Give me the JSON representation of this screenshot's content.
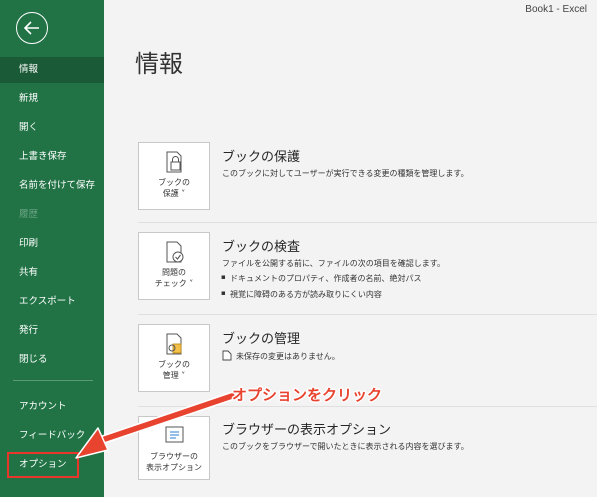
{
  "window": {
    "title": "Book1  -  Excel"
  },
  "sidebar": {
    "items": [
      {
        "label": "情報",
        "active": true
      },
      {
        "label": "新規"
      },
      {
        "label": "開く"
      },
      {
        "label": "上書き保存"
      },
      {
        "label": "名前を付けて保存"
      },
      {
        "label": "履歴",
        "disabled": true
      },
      {
        "label": "印刷"
      },
      {
        "label": "共有"
      },
      {
        "label": "エクスポート"
      },
      {
        "label": "発行"
      },
      {
        "label": "閉じる"
      },
      {
        "label": "アカウント"
      },
      {
        "label": "フィードバック"
      },
      {
        "label": "オプション"
      }
    ]
  },
  "main": {
    "title": "情報",
    "sections": [
      {
        "button_line1": "ブックの",
        "button_line2": "保護 ˅",
        "title": "ブックの保護",
        "desc": "このブックに対してユーザーが実行できる変更の種類を管理します。"
      },
      {
        "button_line1": "問題の",
        "button_line2": "チェック ˅",
        "title": "ブックの検査",
        "desc": "ファイルを公開する前に、ファイルの次の項目を確認します。",
        "bullets": [
          "ドキュメントのプロパティ、作成者の名前、絶対パス",
          "視覚に障碍のある方が読み取りにくい内容"
        ]
      },
      {
        "button_line1": "ブックの",
        "button_line2": "管理 ˅",
        "title": "ブックの管理",
        "desc": "未保存の変更はありません。"
      },
      {
        "button_line1": "ブラウザーの",
        "button_line2": "表示オプション",
        "title": "ブラウザーの表示オプション",
        "desc": "このブックをブラウザーで開いたときに表示される内容を選びます。"
      }
    ]
  },
  "annotation": {
    "callout": "オプションをクリック"
  },
  "colors": {
    "sidebar": "#217346",
    "sidebar_active": "#1a5a36",
    "callout": "#e8432f"
  },
  "icons": {
    "back": "back-arrow-icon",
    "protect": "lock-document-icon",
    "inspect": "check-document-icon",
    "manage": "manage-document-icon",
    "browser": "browser-view-icon"
  }
}
